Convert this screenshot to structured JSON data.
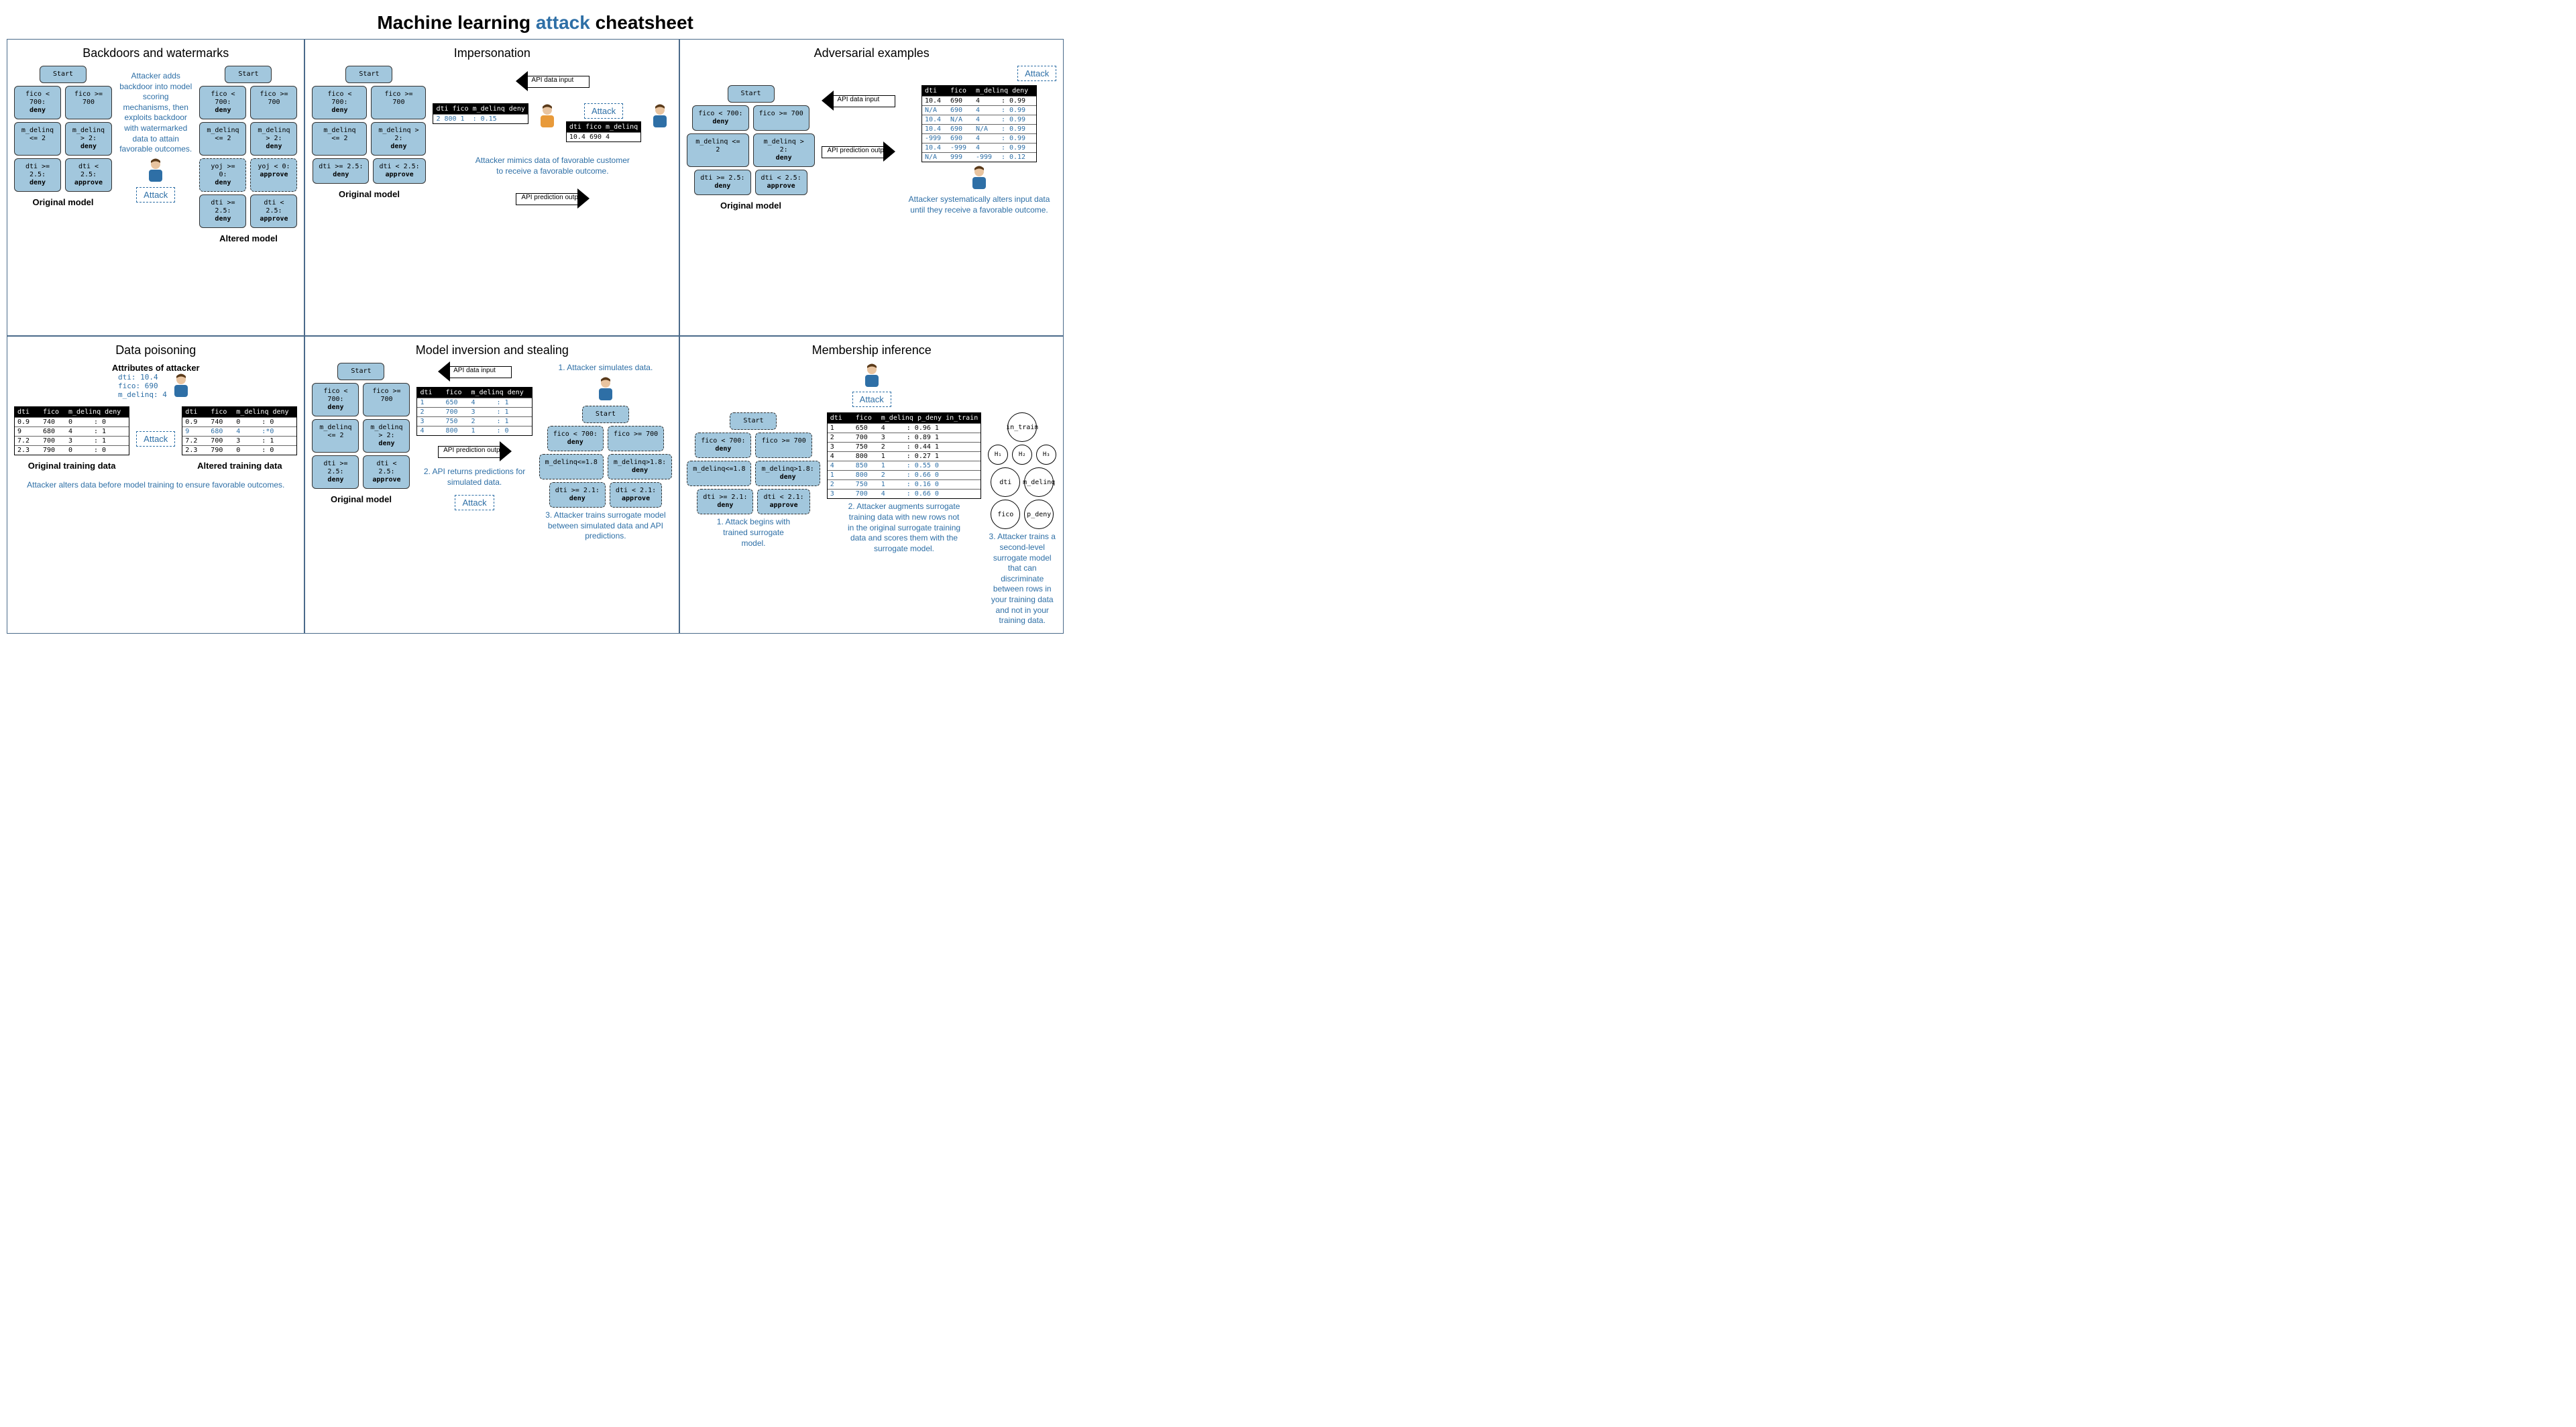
{
  "title_pre": "Machine learning ",
  "title_attack": "attack",
  "title_post": " cheatsheet",
  "attack": "Attack",
  "sections": {
    "backdoors": {
      "title": "Backdoors and watermarks",
      "note": "Attacker adds backdoor into model scoring mechanisms, then exploits backdoor with watermarked data to attain favorable outcomes.",
      "orig": "Original model",
      "alt": "Altered model"
    },
    "imp": {
      "title": "Impersonation",
      "note": "Attacker mimics data of favorable customer to receive a favorable outcome.",
      "api_in": "API data input",
      "api_out": "API prediction output",
      "orig": "Original model"
    },
    "adv": {
      "title": "Adversarial examples",
      "note": "Attacker systematically alters input data until they receive a favorable outcome.",
      "api_in": "API data input",
      "api_out": "API prediction output",
      "orig": "Original model"
    },
    "poison": {
      "title": "Data poisoning",
      "attr": "Attributes of attacker",
      "orig": "Original training data",
      "alt": "Altered training data",
      "note": "Attacker alters data before model training to ensure favorable outcomes."
    },
    "inv": {
      "title": "Model inversion and stealing",
      "s1": "1. Attacker simulates data.",
      "s2": "2. API returns predictions for simulated data.",
      "s3": "3. Attacker trains surrogate model between simulated data and API predictions.",
      "api_in": "API data input",
      "api_out": "API prediction output",
      "orig": "Original model"
    },
    "mem": {
      "title": "Membership inference",
      "s1": "1. Attack begins with trained surrogate model.",
      "s2": "2. Attacker augments surrogate training data with new rows not in the original surrogate training data and scores them with the surrogate model.",
      "s3": "3. Attacker trains a second-level surrogate model that can discriminate between rows in your training data and not in your training data."
    }
  },
  "tree": {
    "start": "Start",
    "l1a": "fico < 700:\ndeny",
    "l1b": "fico >= 700",
    "l2a": "m_delinq <= 2",
    "l2b": "m_delinq > 2:\ndeny",
    "l3a": "dti >= 2.5:\ndeny",
    "l3b": "dti < 2.5:\napprove",
    "yoj0": "yoj >= 0:\ndeny",
    "yoj1": "yoj < 0:\napprove"
  },
  "tree_surr": {
    "l2a": "m_delinq<=1.8",
    "l2b": "m_delinq>1.8:\ndeny",
    "l3a": "dti >= 2.1:\ndeny",
    "l3b": "dti < 2.1:\napprove"
  },
  "poison_attr": {
    "dti": "dti:",
    "dtiv": "10.4",
    "fico": "fico:",
    "ficov": "690",
    "md": "m_delinq:",
    "mdv": "4"
  },
  "poison_hdr": [
    "dti",
    "fico",
    "m_delinq",
    "deny"
  ],
  "poison_rows": [
    [
      "0.9",
      "740",
      "0",
      ": 0"
    ],
    [
      "9",
      "680",
      "4",
      ": 1"
    ],
    [
      "7.2",
      "700",
      "3",
      ": 1"
    ],
    [
      "2.3",
      "790",
      "0",
      ": 0"
    ]
  ],
  "poison_rows_alt": [
    [
      "0.9",
      "740",
      "0",
      ": 0"
    ],
    [
      "9",
      "680",
      "4",
      ":*0"
    ],
    [
      "7.2",
      "700",
      "3",
      ": 1"
    ],
    [
      "2.3",
      "790",
      "0",
      ": 0"
    ]
  ],
  "imp_hdr1": [
    "dti",
    "fico",
    "m_delinq",
    "deny"
  ],
  "imp_row1": [
    "2",
    "800",
    "1",
    ": 0.15"
  ],
  "imp_hdr2": [
    "dti",
    "fico",
    "m_delinq"
  ],
  "imp_row2": [
    "10.4",
    "690",
    "4"
  ],
  "adv_hdr": [
    "dti",
    "fico",
    "m_delinq",
    "deny"
  ],
  "adv_rows": [
    [
      "10.4",
      "690",
      "4",
      ": 0.99"
    ],
    [
      "N/A",
      "690",
      "4",
      ": 0.99"
    ],
    [
      "10.4",
      "N/A",
      "4",
      ": 0.99"
    ],
    [
      "10.4",
      "690",
      "N/A",
      ": 0.99"
    ],
    [
      "-999",
      "690",
      "4",
      ": 0.99"
    ],
    [
      "10.4",
      "-999",
      "4",
      ": 0.99"
    ],
    [
      "N/A",
      "999",
      "-999",
      ": 0.12"
    ]
  ],
  "inv_hdr": [
    "dti",
    "fico",
    "m_delinq",
    "deny"
  ],
  "inv_rows": [
    [
      "1",
      "650",
      "4",
      ": 1"
    ],
    [
      "2",
      "700",
      "3",
      ": 1"
    ],
    [
      "3",
      "750",
      "2",
      ": 1"
    ],
    [
      "4",
      "800",
      "1",
      ": 0"
    ]
  ],
  "mem_hdr": [
    "dti",
    "fico",
    "m_delinq",
    "p_deny",
    "in_train"
  ],
  "mem_rows": [
    [
      "1",
      "650",
      "4",
      ": 0.96",
      "1"
    ],
    [
      "2",
      "700",
      "3",
      ": 0.89",
      "1"
    ],
    [
      "3",
      "750",
      "2",
      ": 0.44",
      "1"
    ],
    [
      "4",
      "800",
      "1",
      ": 0.27",
      "1"
    ],
    [
      "4",
      "850",
      "1",
      ": 0.55",
      "0"
    ],
    [
      "1",
      "800",
      "2",
      ": 0.66",
      "0"
    ],
    [
      "2",
      "750",
      "1",
      ": 0.16",
      "0"
    ],
    [
      "3",
      "700",
      "4",
      ": 0.66",
      "0"
    ]
  ],
  "net": {
    "top": "in_train",
    "h1": "H₁",
    "h2": "H₂",
    "h3": "H₃",
    "dti": "dti",
    "md": "m_delinq",
    "fico": "fico",
    "pd": "p_deny"
  }
}
